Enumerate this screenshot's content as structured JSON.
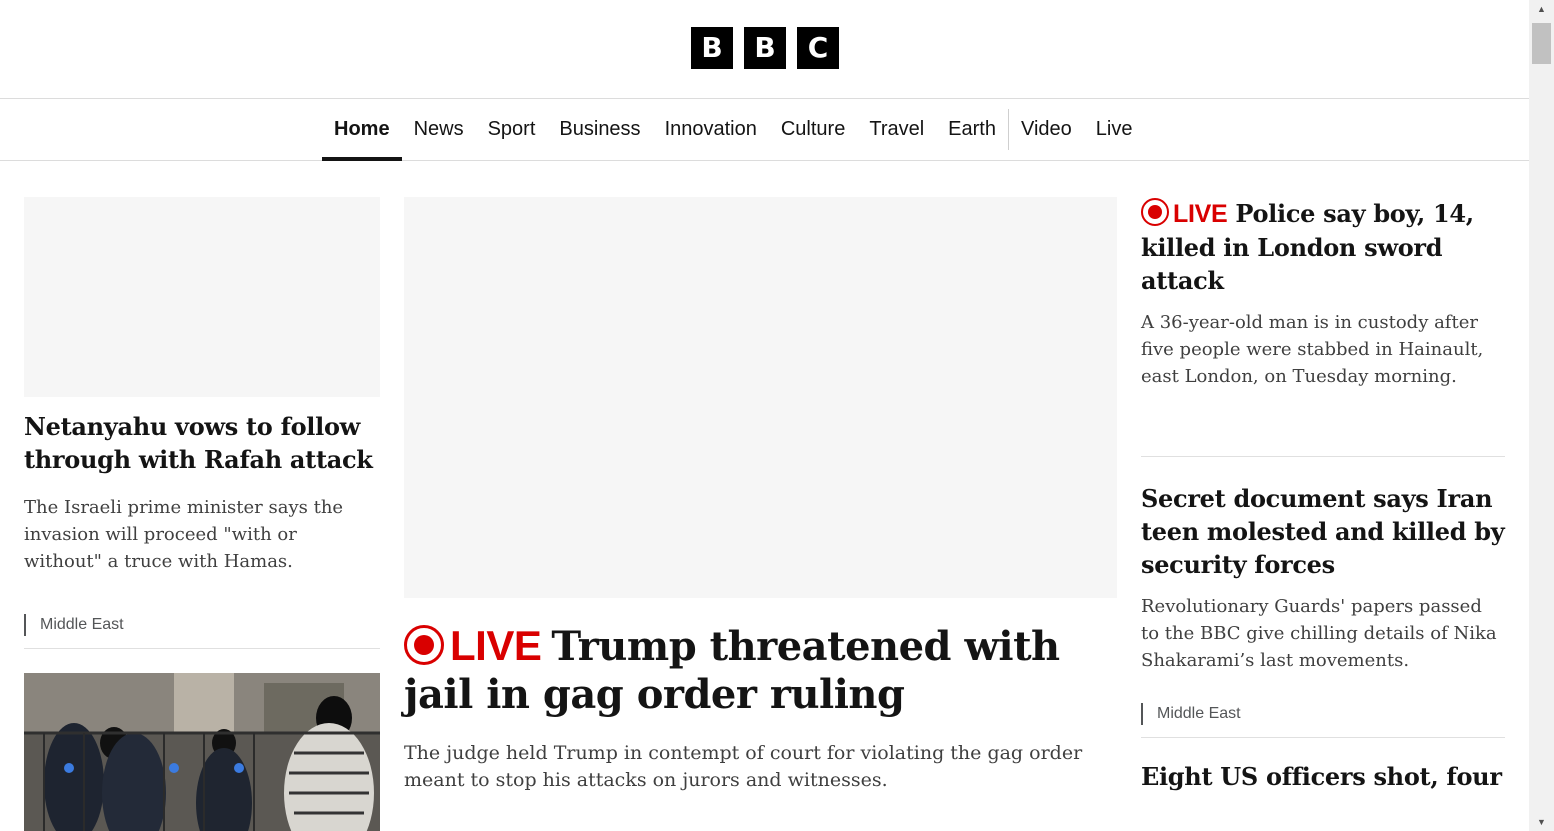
{
  "logo": {
    "letters": [
      "B",
      "B",
      "C"
    ]
  },
  "nav": {
    "items": [
      {
        "label": "Home",
        "active": true
      },
      {
        "label": "News"
      },
      {
        "label": "Sport"
      },
      {
        "label": "Business"
      },
      {
        "label": "Innovation"
      },
      {
        "label": "Culture"
      },
      {
        "label": "Travel"
      },
      {
        "label": "Earth"
      },
      {
        "label": "Video"
      },
      {
        "label": "Live"
      }
    ]
  },
  "left": {
    "story1": {
      "headline": "Netanyahu vows to follow through with Rafah attack",
      "summary": "The Israeli prime minister says the invasion will proceed \"with or without\" a truce with Hamas.",
      "tag": "Middle East"
    }
  },
  "center": {
    "lead": {
      "live_label": "LIVE",
      "headline": "Trump threatened with jail in gag order ruling",
      "summary": "The judge held Trump in contempt of court for violating the gag order meant to stop his attacks on jurors and witnesses."
    }
  },
  "right": {
    "story1": {
      "live_label": "LIVE",
      "headline": "Police say boy, 14, killed in London sword attack",
      "summary": "A 36-year-old man is in custody after five people were stabbed in Hainault, east London, on Tuesday morning."
    },
    "story2": {
      "headline": "Secret document says Iran teen molested and killed by security forces",
      "summary": "Revolutionary Guards' papers passed to the BBC give chilling details of Nika Shakarami’s last movements.",
      "tag": "Middle East"
    },
    "story3": {
      "headline": "Eight US officers shot, four"
    }
  },
  "colors": {
    "live_red": "#d90000",
    "text": "#141414",
    "placeholder": "#f6f6f6"
  },
  "icons": {
    "live": "live-indicator-icon",
    "scroll_up": "scroll-up-arrow-icon",
    "scroll_down": "scroll-down-arrow-icon"
  }
}
